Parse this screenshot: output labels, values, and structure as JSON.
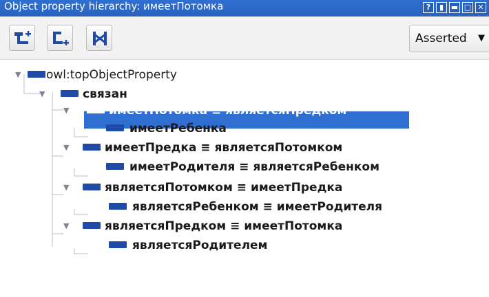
{
  "window": {
    "title": "Object property hierarchy: имеетПотомка",
    "buttons": [
      "?",
      "▮",
      "▬",
      "□",
      "✕"
    ]
  },
  "toolbar": {
    "buttons": [
      {
        "name": "add-subproperty",
        "icon": "add-subproperty-icon"
      },
      {
        "name": "add-sibling-property",
        "icon": "add-sibling-icon"
      },
      {
        "name": "delete-property",
        "icon": "delete-property-icon"
      }
    ],
    "view_mode": "Asserted",
    "view_mode_caret": "▼"
  },
  "tree": {
    "nodes": [
      {
        "label": "owl:topObjectProperty",
        "depth": 0,
        "expanded": true,
        "selected": false
      },
      {
        "label": "связан",
        "depth": 1,
        "expanded": true,
        "selected": false
      },
      {
        "label": "имеетПотомка ≡ являетсяПредком",
        "depth": 2,
        "expanded": true,
        "selected": true
      },
      {
        "label": "имеетРебенка",
        "depth": 3,
        "expanded": false,
        "selected": false
      },
      {
        "label": "имеетПредка ≡ являетсяПотомком",
        "depth": 2,
        "expanded": true,
        "selected": false
      },
      {
        "label": "имеетРодителя ≡ являетсяРебенком",
        "depth": 3,
        "expanded": false,
        "selected": false
      },
      {
        "label": "являетсяПотомком ≡ имеетПредка",
        "depth": 2,
        "expanded": true,
        "selected": false
      },
      {
        "label": "являетсяРебенком ≡ имеетРодителя",
        "depth": 3,
        "expanded": false,
        "selected": false
      },
      {
        "label": "являетсяПредком ≡ имеетПотомка",
        "depth": 2,
        "expanded": true,
        "selected": false
      },
      {
        "label": "являетсяРодителем",
        "depth": 3,
        "expanded": false,
        "selected": false
      }
    ]
  },
  "colors": {
    "selection": "#2f6fd1",
    "property_icon": "#1f4aa8",
    "titlebar": "#2f6fd1"
  }
}
